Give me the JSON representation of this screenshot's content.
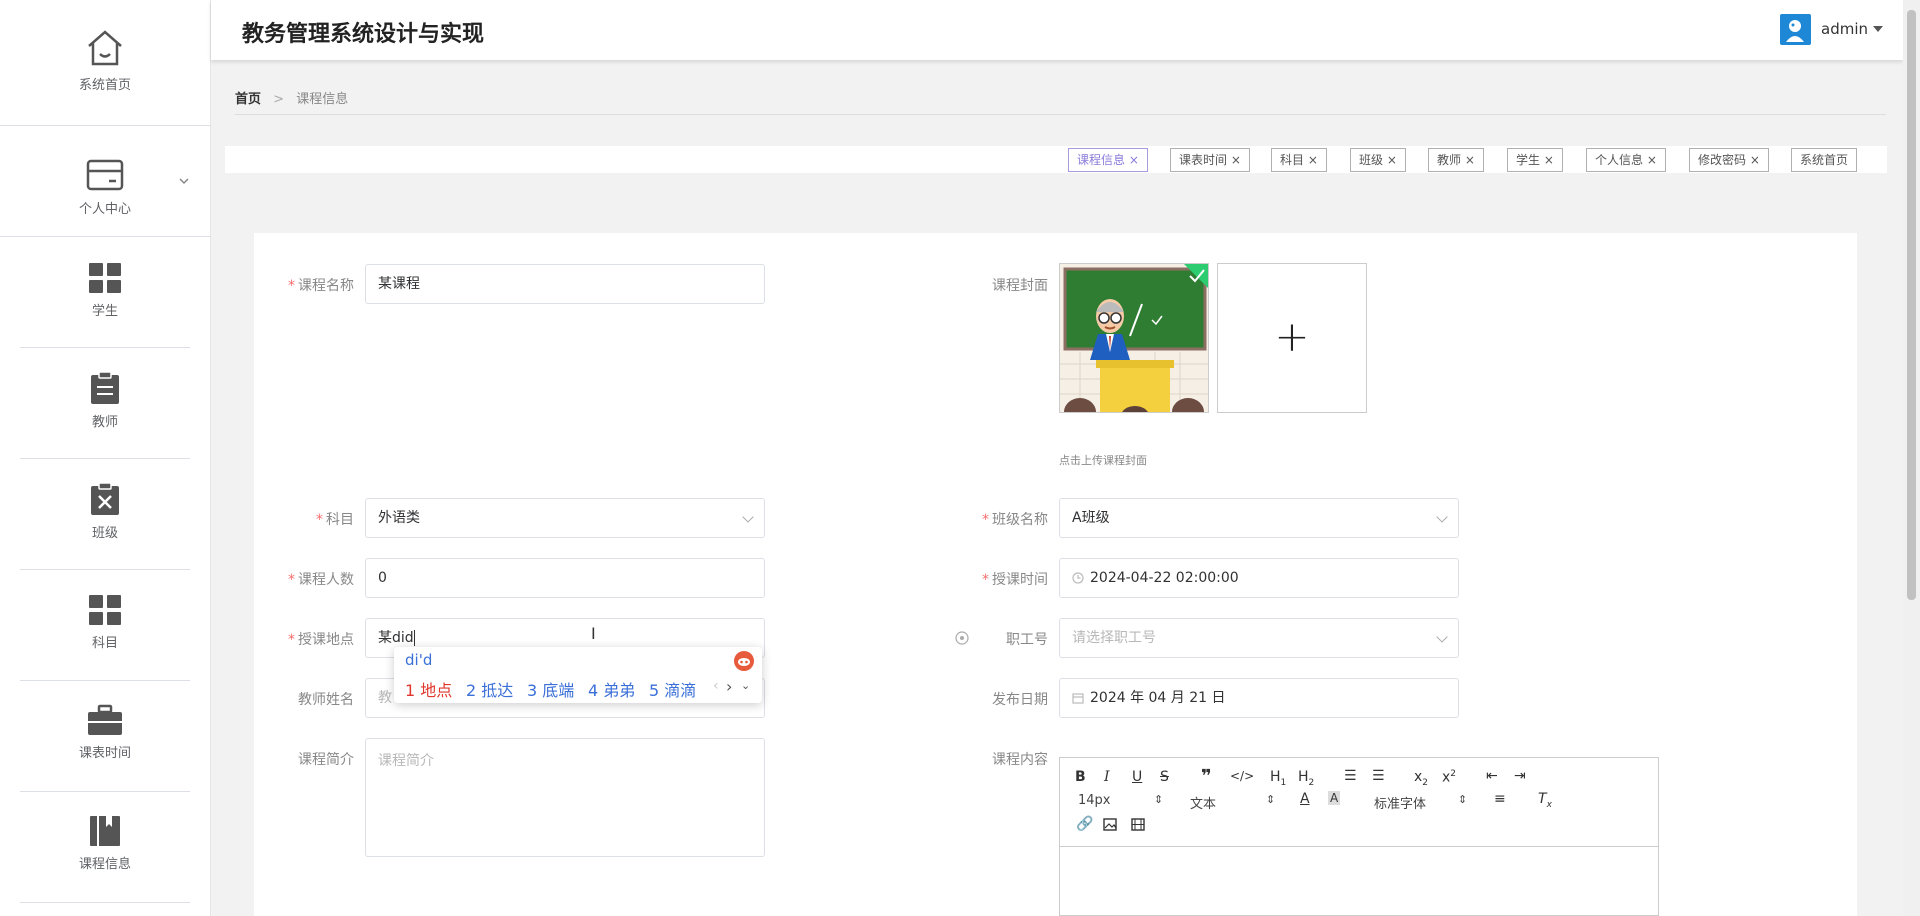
{
  "header": {
    "title": "教务管理系统设计与实现",
    "user": "admin"
  },
  "sidebar": {
    "items": [
      {
        "label": "系统首页",
        "icon": "home-icon"
      },
      {
        "label": "个人中心",
        "icon": "wallet-icon"
      },
      {
        "label": "学生",
        "icon": "grid-icon"
      },
      {
        "label": "教师",
        "icon": "clipboard-icon"
      },
      {
        "label": "班级",
        "icon": "clipboard-x-icon"
      },
      {
        "label": "科目",
        "icon": "grid-icon"
      },
      {
        "label": "课表时间",
        "icon": "briefcase-icon"
      },
      {
        "label": "课程信息",
        "icon": "book-icon"
      }
    ]
  },
  "breadcrumb": {
    "home": "首页",
    "sep": ">",
    "current": "课程信息"
  },
  "tags": [
    "课程信息",
    "课表时间",
    "科目",
    "班级",
    "教师",
    "学生",
    "个人信息",
    "修改密码",
    "系统首页"
  ],
  "form": {
    "course_name": {
      "label": "课程名称",
      "value": "某课程"
    },
    "cover": {
      "label": "课程封面",
      "hint": "点击上传课程封面",
      "plus": "+"
    },
    "subject": {
      "label": "科目",
      "value": "外语类"
    },
    "class_name": {
      "label": "班级名称",
      "value": "A班级"
    },
    "count": {
      "label": "课程人数",
      "value": "0"
    },
    "time": {
      "label": "授课时间",
      "value": "2024-04-22 02:00:00"
    },
    "place": {
      "label": "授课地点",
      "value": "某did"
    },
    "staff_no": {
      "label": "职工号",
      "placeholder": "请选择职工号"
    },
    "teacher": {
      "label": "教师姓名",
      "placeholder": "教"
    },
    "publish": {
      "label": "发布日期",
      "value": "2024 年 04 月 21 日"
    },
    "intro": {
      "label": "课程简介",
      "placeholder": "课程简介"
    },
    "content": {
      "label": "课程内容"
    }
  },
  "ime": {
    "input": "di'd",
    "candidates": [
      "1 地点",
      "2 抵达",
      "3 底端",
      "4 弟弟",
      "5 滴滴"
    ]
  },
  "editor": {
    "font_size": "14px",
    "block": "文本",
    "font": "标准字体"
  },
  "colors": {
    "accent": "#8a7cd8",
    "required": "#f56c6c",
    "ime_selected": "#e0362c",
    "ime_text": "#3a6fd8"
  }
}
